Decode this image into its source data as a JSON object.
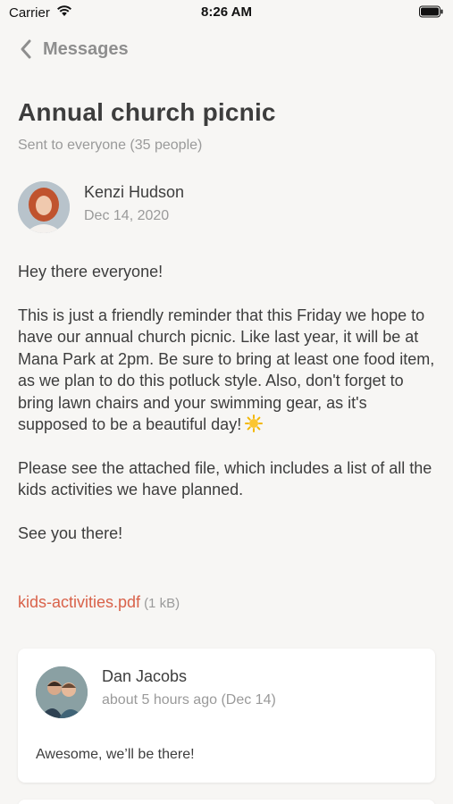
{
  "status_bar": {
    "carrier": "Carrier",
    "time": "8:26 AM"
  },
  "nav": {
    "back_label": "Messages"
  },
  "message": {
    "title": "Annual church picnic",
    "recipients": "Sent to everyone (35 people)",
    "author": {
      "name": "Kenzi Hudson",
      "date": "Dec 14, 2020"
    },
    "paragraphs": [
      "Hey there everyone!",
      "This is just a friendly reminder that this Friday we hope to have our annual church picnic. Like last year, it will be at Mana Park at 2pm. Be sure to bring at least one food item, as we plan to do this potluck style. Also, don't forget to bring lawn chairs and your swimming gear, as it's supposed to be a beautiful day!",
      "Please see the attached file, which includes a list of all the kids activities we have planned.",
      "See you there!"
    ],
    "attachment": {
      "filename": "kids-activities.pdf",
      "size": "(1 kB)"
    }
  },
  "replies": [
    {
      "name": "Dan Jacobs",
      "time": "about 5 hours ago (Dec 14)",
      "text": "Awesome, we’ll be there!"
    }
  ],
  "colors": {
    "link": "#d9624a",
    "muted": "#9a9a9a",
    "background": "#f7f6f4"
  }
}
